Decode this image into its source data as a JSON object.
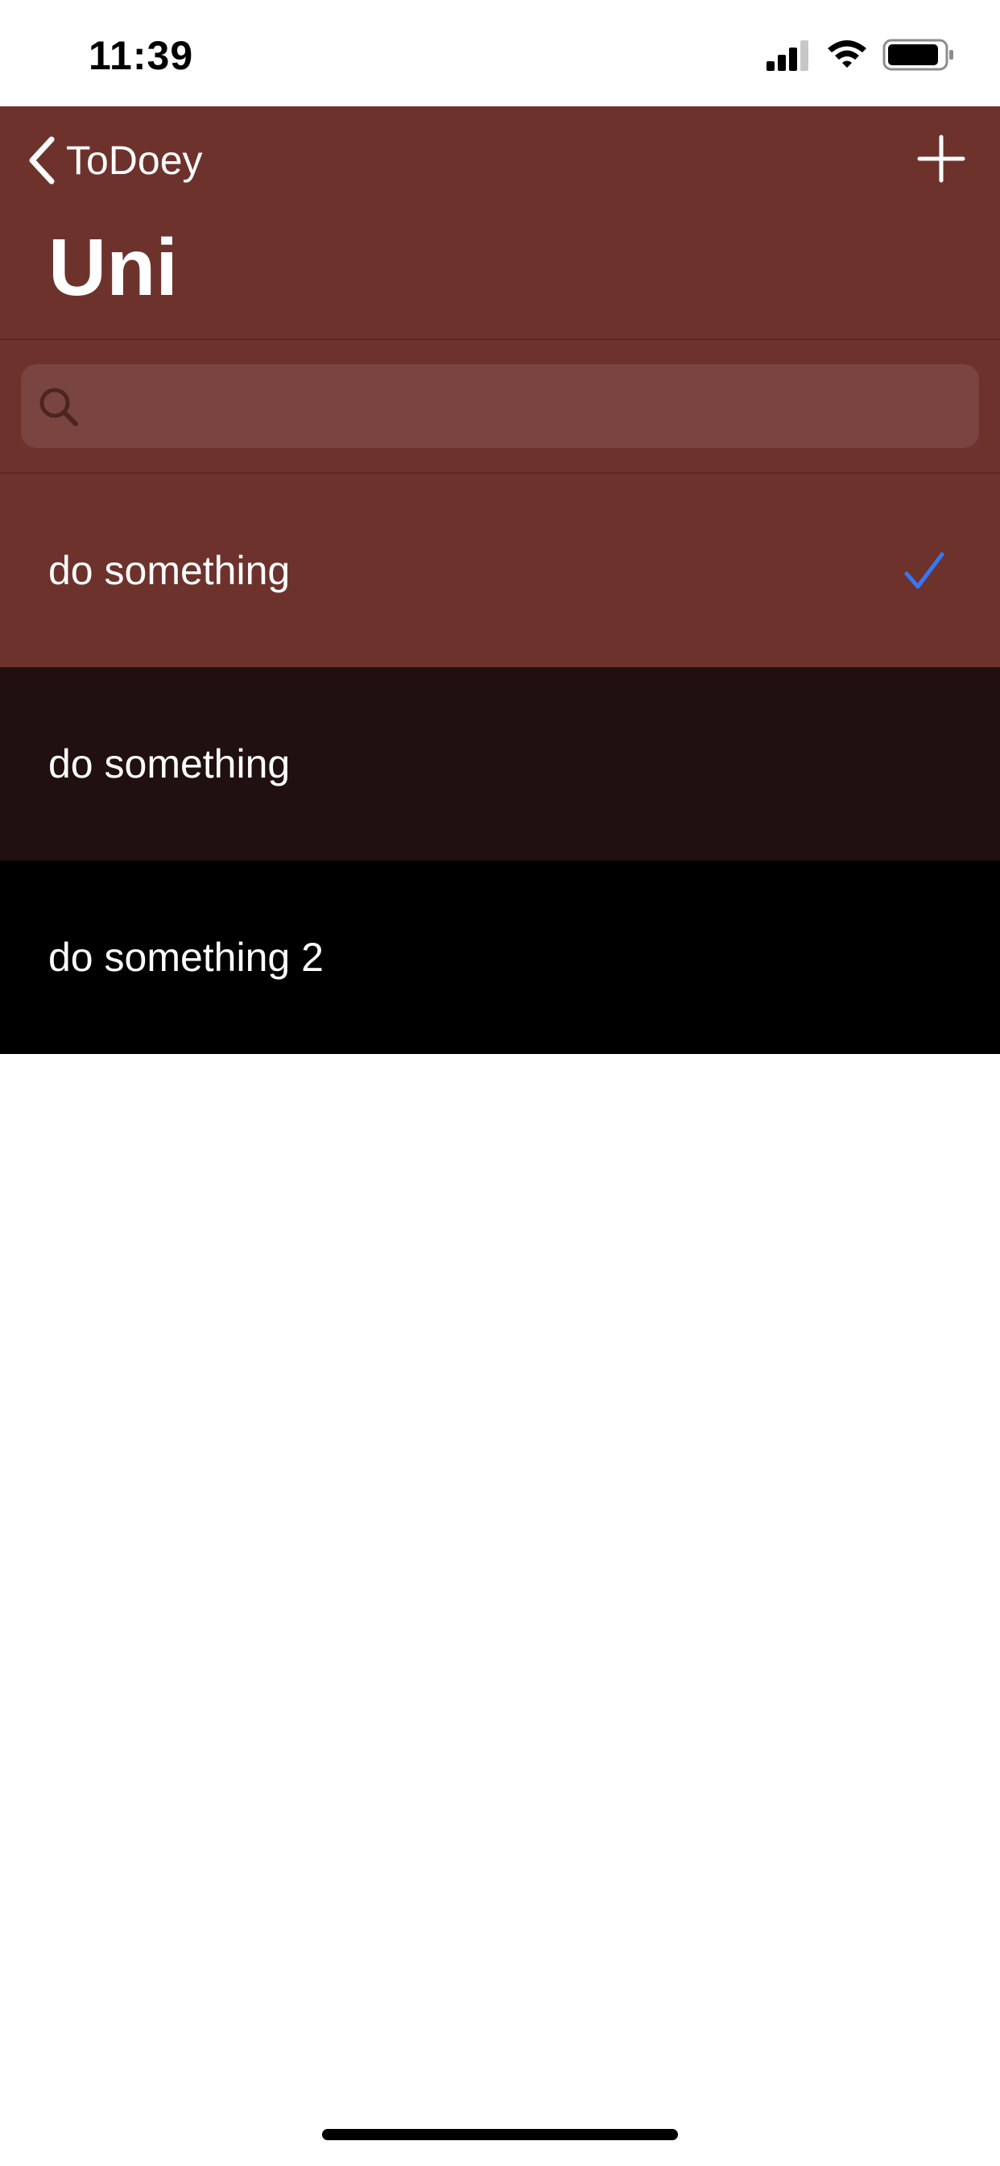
{
  "status_bar": {
    "time": "11:39",
    "signal_icon": "cellular-signal-icon",
    "wifi_icon": "wifi-icon",
    "battery_icon": "battery-icon"
  },
  "nav": {
    "back_icon": "chevron-left-icon",
    "back_label": "ToDoey",
    "add_icon": "plus-icon",
    "title": "Uni",
    "background_color": "#6e322d"
  },
  "search": {
    "icon": "search-icon",
    "value": "",
    "placeholder": ""
  },
  "items": [
    {
      "label": "do something",
      "checked": true,
      "color": "#6e322d"
    },
    {
      "label": "do something",
      "checked": false,
      "color": "#211010"
    },
    {
      "label": "do something 2",
      "checked": false,
      "color": "#000000"
    }
  ],
  "colors": {
    "checkmark": "#3478f6",
    "nav_background": "#6e322d"
  }
}
